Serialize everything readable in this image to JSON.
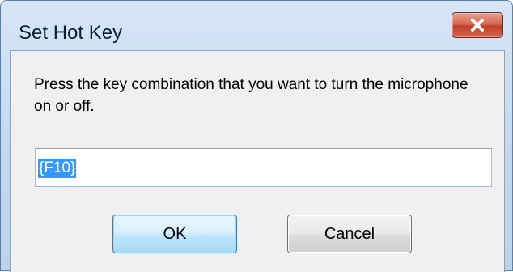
{
  "window": {
    "title": "Set Hot Key",
    "close_icon": "close-icon"
  },
  "dialog": {
    "prompt": "Press the key combination that you want to turn the microphone on or off.",
    "hotkey_value": "{F10}",
    "ok_label": "OK",
    "cancel_label": "Cancel"
  },
  "colors": {
    "close_button": "#c7462e",
    "selection": "#3399ff",
    "ok_button_border": "#3c7fb1"
  }
}
